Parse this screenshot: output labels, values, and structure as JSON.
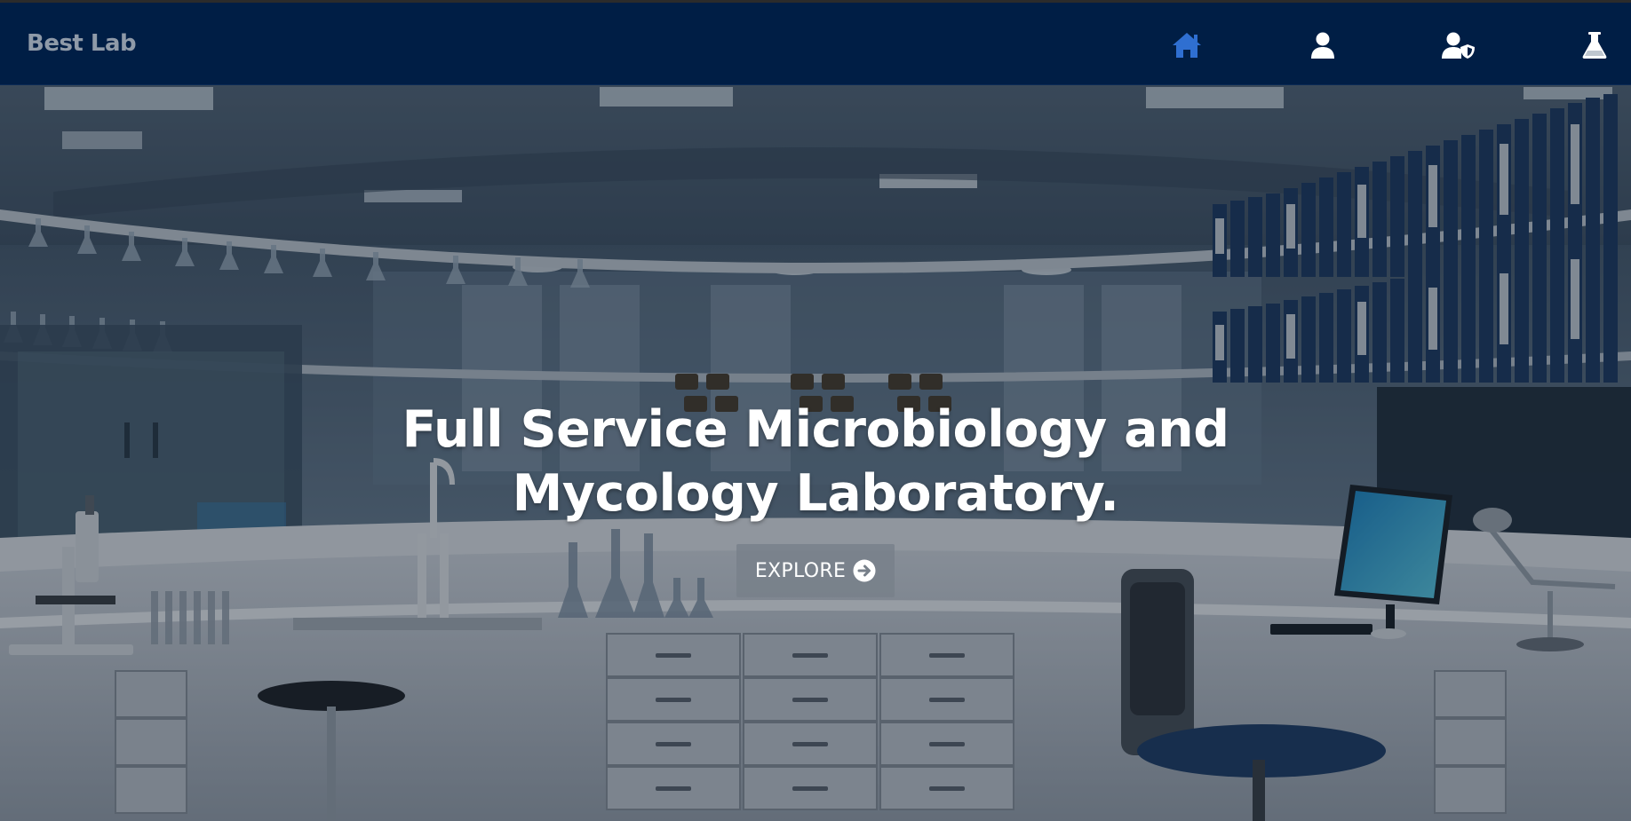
{
  "window": {
    "title": "Best Lab"
  },
  "navbar": {
    "brand": "Best Lab",
    "icons": [
      {
        "name": "home-icon",
        "color": "#2f6fd1"
      },
      {
        "name": "user-icon",
        "color": "#ffffff"
      },
      {
        "name": "user-shield-icon",
        "color": "#ffffff"
      },
      {
        "name": "flask-icon",
        "color": "#ffffff"
      }
    ]
  },
  "hero": {
    "title": "Full Service Microbiology and Mycology Laboratory.",
    "explore_label": "EXPLORE",
    "explore_icon": "arrow-circle-right-icon"
  },
  "colors": {
    "navbar_bg": "#001e45",
    "brand_text": "#8f9aa8",
    "active_icon": "#2f6fd1",
    "button_bg": "#78808a"
  }
}
